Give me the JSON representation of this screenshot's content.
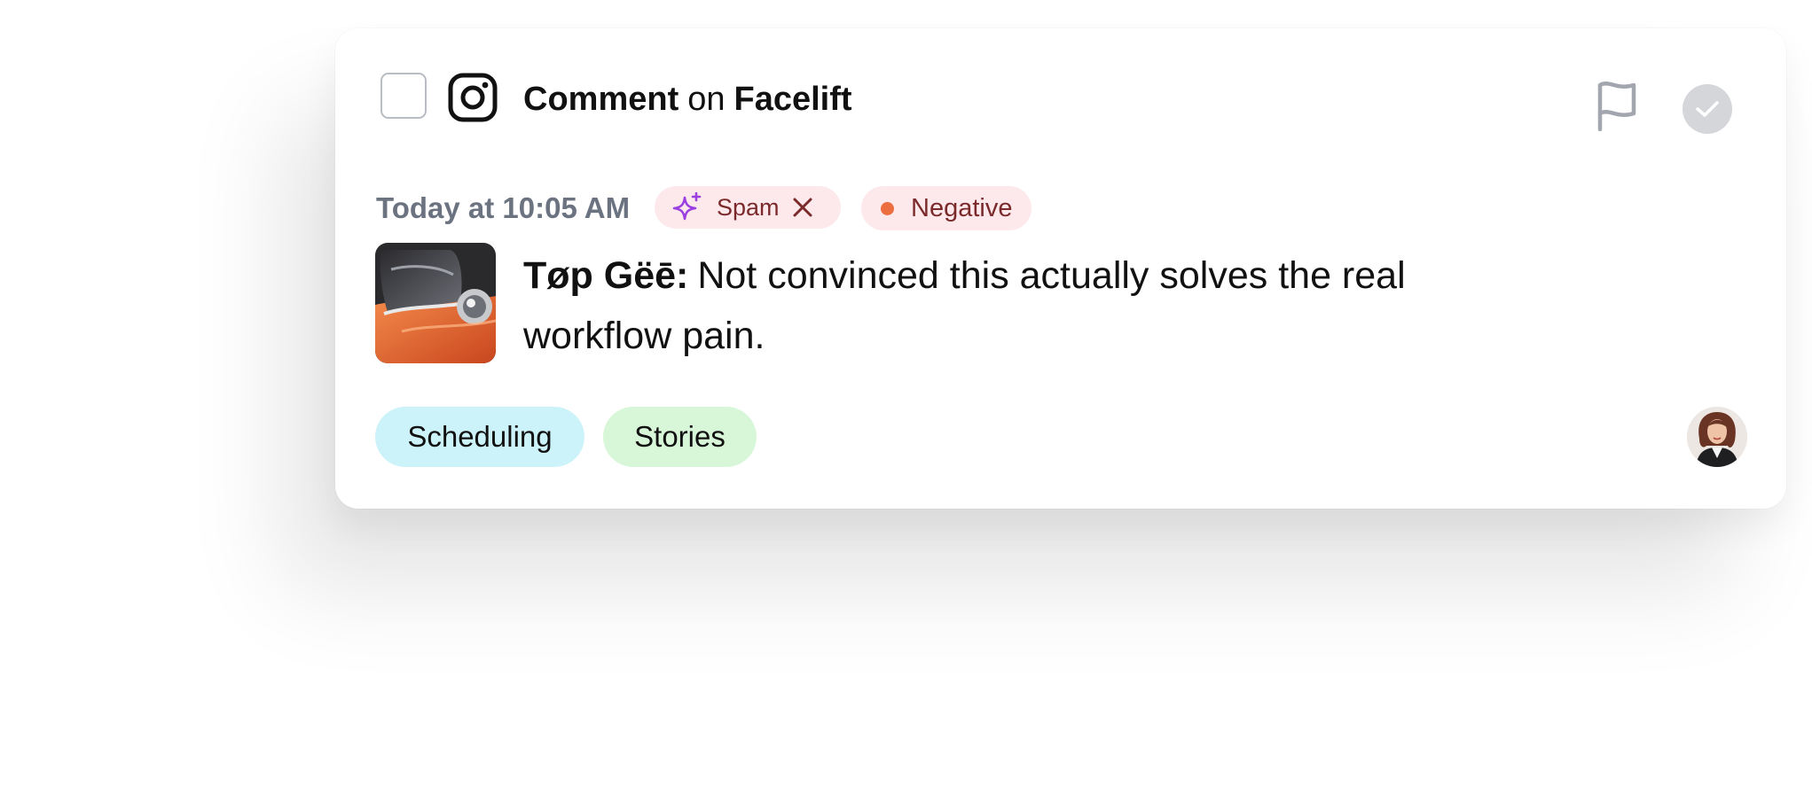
{
  "item": {
    "action": "Comment",
    "connector": "on",
    "target": "Facelift",
    "platform_icon": "instagram-icon",
    "timestamp": "Today at 10:05 AM",
    "labels": {
      "spam": "Spam",
      "sentiment": "Negative"
    },
    "comment": {
      "author": "Tøp Gëē:",
      "text": "Not convinced this actually solves the real workflow pain."
    },
    "tags": [
      "Scheduling",
      "Stories"
    ]
  },
  "colors": {
    "spam_badge_bg": "#fde9ec",
    "spam_sparkle": "#9b3fe0",
    "negative_dot": "#ec6d3f",
    "tag_scheduling_bg": "#cdf3fa",
    "tag_stories_bg": "#d8f6d8",
    "timestamp_text": "#6b7280"
  }
}
